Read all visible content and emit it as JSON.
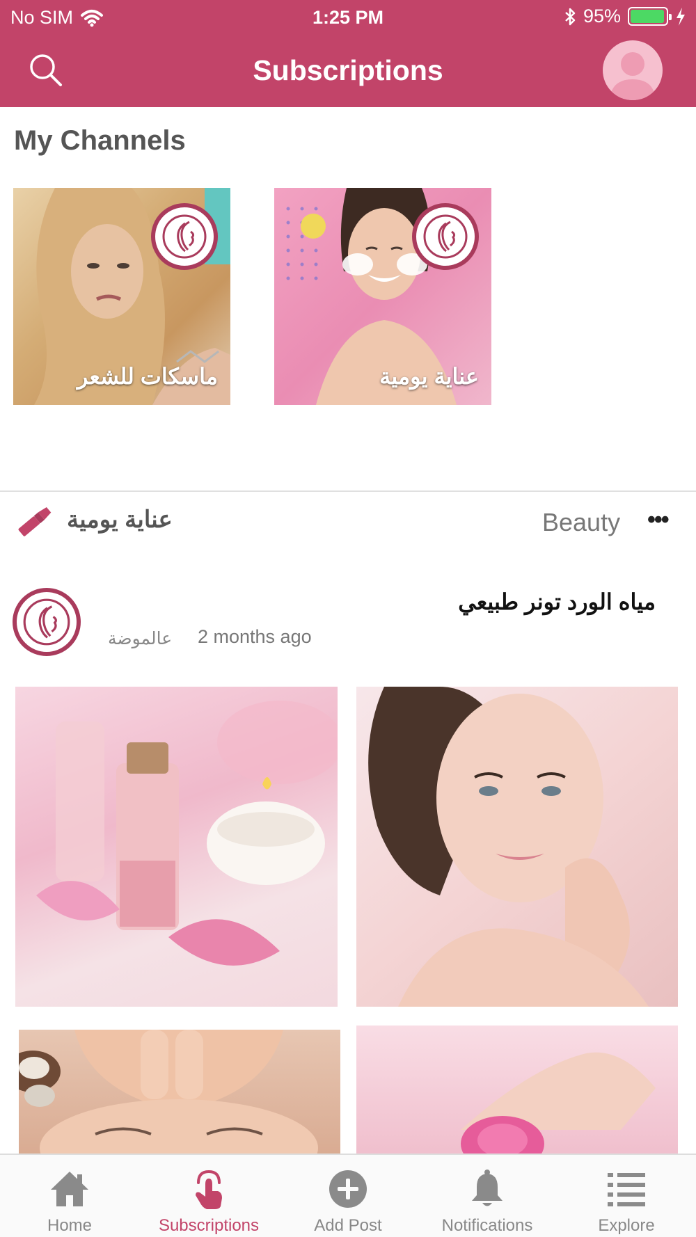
{
  "status_bar": {
    "carrier": "No SIM",
    "time": "1:25 PM",
    "battery": "95%",
    "battery_level": 0.95
  },
  "nav": {
    "title": "Subscriptions"
  },
  "my_channels": {
    "title": "My Channels",
    "items": [
      {
        "label": "ماسكات للشعر"
      },
      {
        "label": "عناية يومية"
      }
    ]
  },
  "post": {
    "channel": "عناية يومية",
    "category": "Beauty",
    "more": "•••",
    "title": "مياه الورد تونر طبيعي",
    "author": "عالموضة",
    "time": "2 months ago"
  },
  "tabs": [
    {
      "label": "Home",
      "icon": "home-icon",
      "active": false
    },
    {
      "label": "Subscriptions",
      "icon": "tap-hand-icon",
      "active": true
    },
    {
      "label": "Add Post",
      "icon": "plus-circle-icon",
      "active": false
    },
    {
      "label": "Notifications",
      "icon": "bell-icon",
      "active": false
    },
    {
      "label": "Explore",
      "icon": "list-icon",
      "active": false
    }
  ],
  "colors": {
    "brand": "#c24469",
    "active_tab": "#c24469",
    "inactive_tab": "#888888"
  }
}
